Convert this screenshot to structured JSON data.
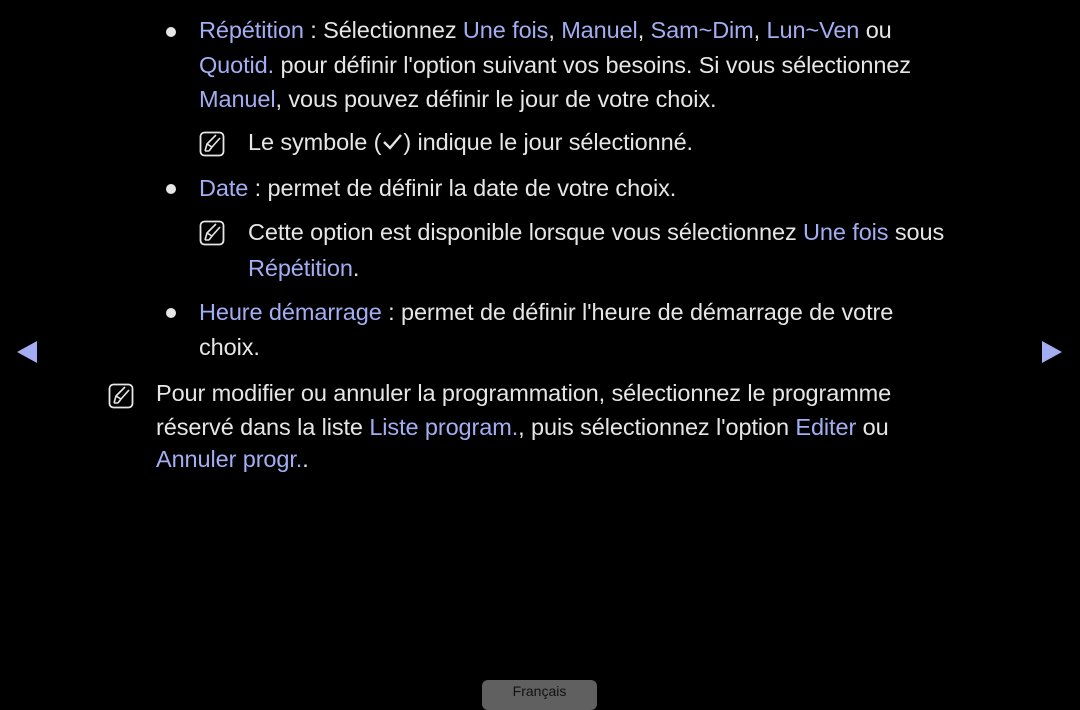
{
  "colors": {
    "background": "#000000",
    "text": "#e6e6e6",
    "highlight": "#a3aef2"
  },
  "items": {
    "repetition": {
      "l1": {
        "term": "Répétition",
        "t1": " : Sélectionnez ",
        "o1": "Une fois",
        "s1": ", ",
        "o2": "Manuel",
        "s2": ", ",
        "o3": "Sam~Dim",
        "s3": ", ",
        "o4": "Lun~Ven",
        "t2": " ou"
      },
      "l2": {
        "o5": "Quotid.",
        "t": " pour définir l'option suivant vos besoins. Si vous sélectionnez"
      },
      "l3": {
        "o": "Manuel",
        "t": ", vous pouvez définir le jour de votre choix."
      },
      "note": {
        "before": "Le symbole (",
        "after": ") indique le jour sélectionné.",
        "icon": "checkmark-icon"
      }
    },
    "date": {
      "l1": {
        "term": "Date",
        "t": " : permet de définir la date de votre choix."
      },
      "note": {
        "t1": "Cette option est disponible lorsque vous sélectionnez ",
        "o1": "Une fois",
        "t2": " sous",
        "o2": "Répétition",
        "t3": "."
      }
    },
    "heure": {
      "l1": {
        "term": "Heure démarrage",
        "t": " : permet de définir l'heure de démarrage de votre"
      },
      "l2": "choix."
    }
  },
  "main_note": {
    "l1": "Pour modifier ou annuler la programmation, sélectionnez le programme",
    "l2": {
      "t1": "réservé dans la liste ",
      "o1": "Liste program.",
      "t2": ", puis sélectionnez l'option ",
      "o2": "Editer",
      "t3": " ou"
    },
    "l3": {
      "o": "Annuler progr.",
      "t": "."
    }
  },
  "nav": {
    "prev_icon": "left-triangle-icon",
    "next_icon": "right-triangle-icon"
  },
  "footer": {
    "language": "Français"
  }
}
